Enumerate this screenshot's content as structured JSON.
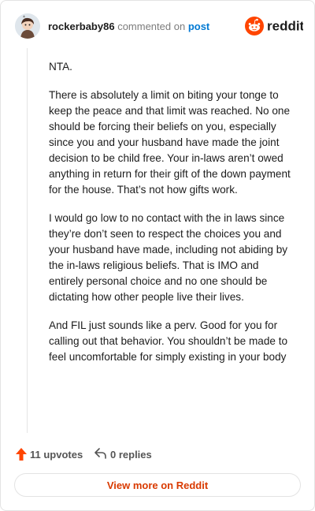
{
  "comment": {
    "username": "rockerbaby86",
    "action_text": "commented on",
    "post_link": "post",
    "paragraphs": [
      "NTA.",
      "There is absolutely a limit on biting your tonge to keep the peace and that limit was reached. No one should be forcing their beliefs on you, especially since you and your husband have made the joint decision to be child free. Your in-laws aren’t owed anything in return for their gift of the down payment for the house. That’s not how gifts work.",
      "I would go low to no contact with the in laws since they’re don’t seen to respect the choices you and your husband have made, including not abiding by the in-laws religious beliefs. That is IMO and entirely personal choice and no one should be dictating how other people live their lives.",
      "And FIL just sounds like a perv. Good for you for calling out that behavior. You shouldn’t be made to feel uncomfortable for simply existing in your body"
    ]
  },
  "brand": {
    "name": "reddit",
    "color": "#ff4500"
  },
  "actions": {
    "upvotes": "11 upvotes",
    "replies": "0 replies",
    "upvote_icon": "upvote-arrow-icon",
    "reply_icon": "reply-arrow-icon"
  },
  "view_more_label": "View more on Reddit"
}
